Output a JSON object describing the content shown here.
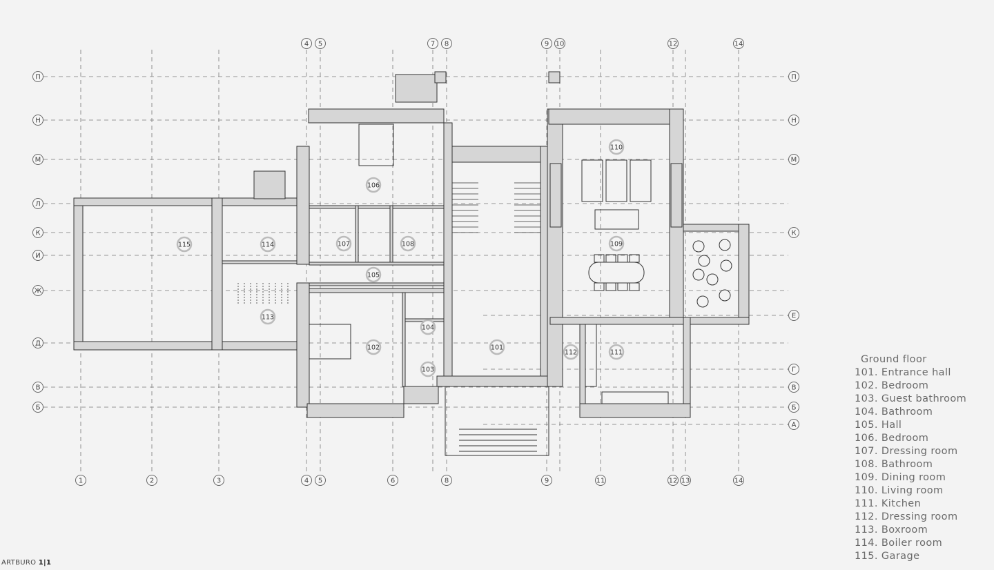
{
  "plan": {
    "vertical_axes": [
      "1",
      "2",
      "3",
      "4",
      "5",
      "6",
      "7",
      "8",
      "9",
      "10",
      "11",
      "12",
      "13",
      "14"
    ],
    "top_axis_labels": [
      "4",
      "5",
      "7",
      "8",
      "9",
      "10",
      "12",
      "14"
    ],
    "bottom_axis_labels": [
      "1",
      "2",
      "3",
      "4",
      "5",
      "6",
      "8",
      "9",
      "11",
      "12",
      "13",
      "14"
    ],
    "horizontal_axes": [
      "П",
      "Н",
      "М",
      "Л",
      "К",
      "И",
      "Ж",
      "Е",
      "Д",
      "Г",
      "В",
      "Б",
      "А"
    ],
    "left_axis_labels": [
      "П",
      "Н",
      "М",
      "Л",
      "К",
      "И",
      "Ж",
      "Д",
      "В",
      "Б"
    ],
    "right_axis_labels": [
      "П",
      "Н",
      "М",
      "К",
      "Е",
      "Г",
      "В",
      "Б",
      "А"
    ],
    "room_tags": [
      "101",
      "102",
      "103",
      "104",
      "105",
      "106",
      "107",
      "108",
      "109",
      "110",
      "111",
      "112",
      "113",
      "114",
      "115"
    ]
  },
  "legend": {
    "title": "Ground floor",
    "items": [
      "101. Entrance hall",
      "102. Bedroom",
      "103. Guest bathroom",
      "104. Bathroom",
      "105. Hall",
      "106. Bedroom",
      "107. Dressing room",
      "108. Bathroom",
      "109. Dining room",
      "110. Living room",
      "111. Kitchen",
      "112. Dressing room",
      "113. Boxroom",
      "114. Boiler room",
      "115. Garage"
    ]
  },
  "footer": {
    "brand": "ARTBURO",
    "page": "1|1"
  },
  "colors": {
    "background": "#f3f3f3",
    "wall_fill": "#d6d6d6",
    "line": "#333333",
    "grid": "#777777"
  }
}
